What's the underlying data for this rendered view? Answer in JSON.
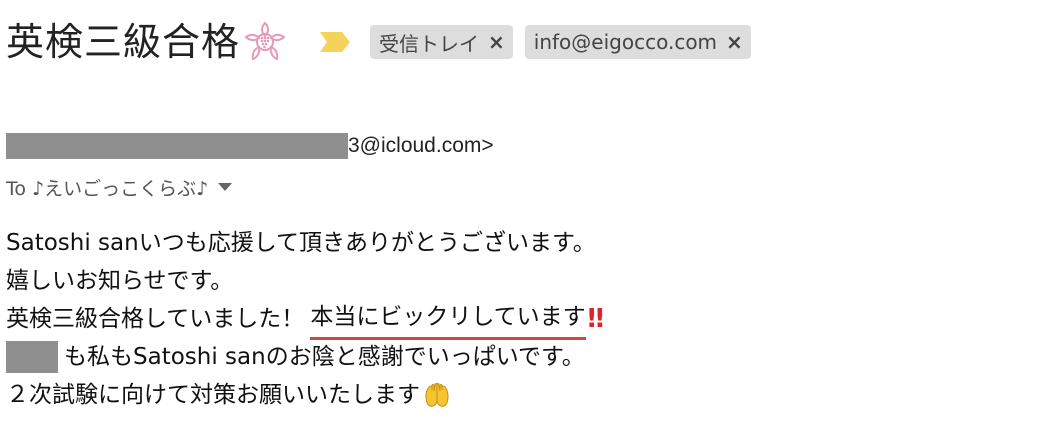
{
  "header": {
    "subject": "英検三級合格",
    "stamp_icon": "sakura-stamp-icon",
    "importance_icon": "importance-marker-icon",
    "labels": [
      {
        "text": "受信トレイ",
        "close": "×"
      },
      {
        "text": "info@eigocco.com",
        "close": "×"
      }
    ]
  },
  "message": {
    "sender_visible": "3@icloud.com>",
    "recipient": "To ♪えいごっこくらぶ♪"
  },
  "body": {
    "line1": "Satoshi sanいつも応援して頂きありがとうございます。",
    "line2": "嬉しいお知らせです。",
    "line3_plain": "英検三級合格していました！",
    "line3_underlined": "本当にビックリしています",
    "line3_emoji": "‼︎",
    "line4": "も私もSatoshi sanのお陰と感謝でいっぱいです。",
    "line5": "２次試験に向けて対策お願いいたします",
    "line5_emoji": "raised-hands-icon"
  },
  "colors": {
    "label_bg": "#dddddd",
    "importance": "#f3d35a",
    "underline": "#d0473f",
    "redaction": "#8f8f8f",
    "stamp": "#e79ab6"
  }
}
